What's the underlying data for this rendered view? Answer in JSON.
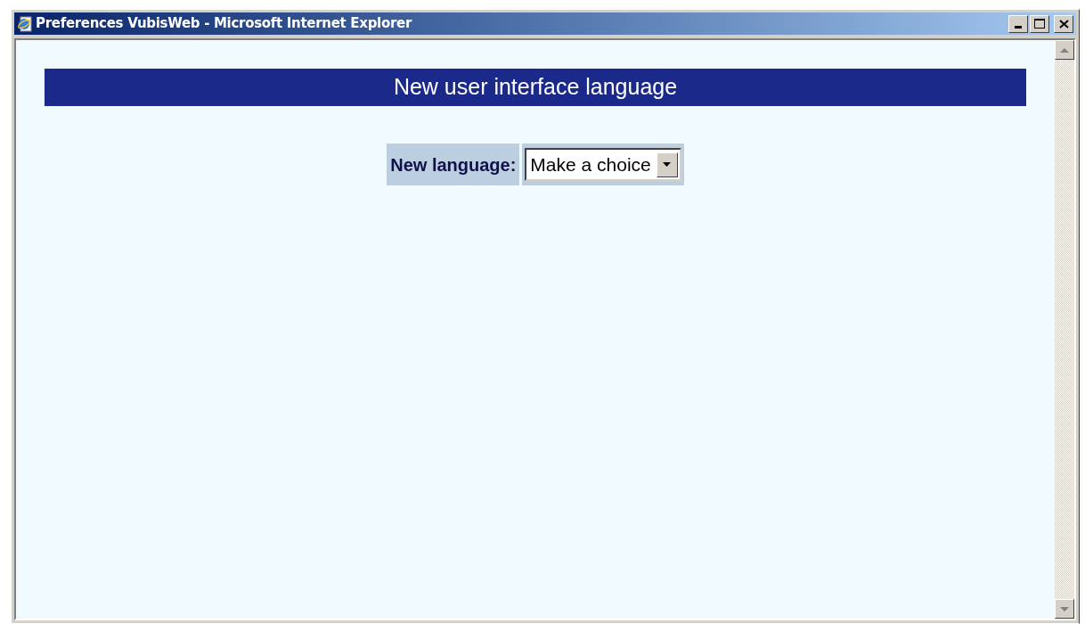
{
  "window": {
    "title": "Preferences VubisWeb - Microsoft Internet Explorer"
  },
  "page": {
    "heading": "New user interface language",
    "field": {
      "label": "New language:",
      "value": "Make a choice"
    }
  }
}
